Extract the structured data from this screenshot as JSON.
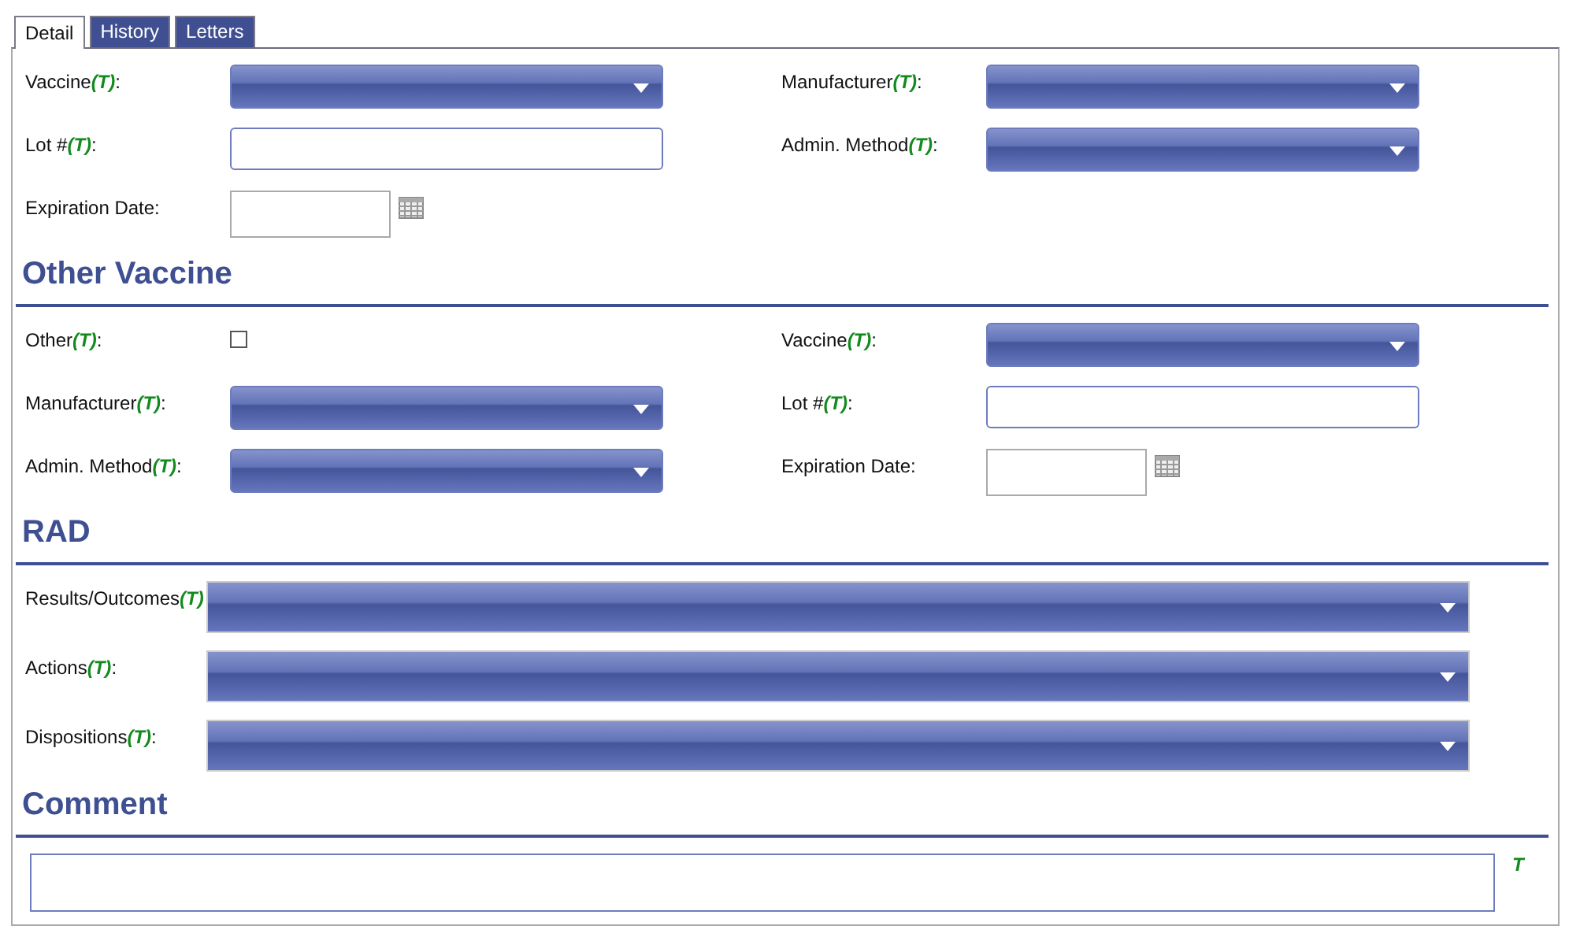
{
  "tabs": [
    {
      "label": "Detail",
      "selected": true
    },
    {
      "label": "History",
      "selected": false
    },
    {
      "label": "Letters",
      "selected": false
    }
  ],
  "sections": [
    {
      "kind": "grid",
      "fields": [
        {
          "label": "Vaccine**(T)**:",
          "kind": "select"
        },
        {
          "label": "Manufacturer**(T)**:",
          "kind": "select"
        },
        {
          "label": "Lot #**(T)**:",
          "kind": "text"
        },
        {
          "label": "Admin. Method**(T)**:",
          "kind": "select"
        },
        {
          "label": "Expiration Date:",
          "kind": "date"
        }
      ]
    },
    {
      "title": "Other Vaccine",
      "kind": "grid",
      "fields": [
        {
          "label": "Other**(T)**:",
          "kind": "checkbox",
          "checked": false
        },
        {
          "label": "Vaccine**(T)**:",
          "kind": "select"
        },
        {
          "label": "Manufacturer**(T)**:",
          "kind": "select"
        },
        {
          "label": "Lot #**(T)**:",
          "kind": "text"
        },
        {
          "label": "Admin. Method**(T)**:",
          "kind": "select"
        },
        {
          "label": "Expiration Date:",
          "kind": "date"
        }
      ]
    },
    {
      "title": "RAD",
      "kind": "wide",
      "fields": [
        {
          "label": "Results/Outcomes**(T)**",
          "kind": "select"
        },
        {
          "label": "Actions**(T)**:",
          "kind": "select"
        },
        {
          "label": "Dispositions**(T)**:",
          "kind": "select"
        }
      ]
    },
    {
      "title": "Comment",
      "kind": "comment",
      "fields": [
        {
          "label": "T",
          "kind": "textarea"
        }
      ]
    }
  ]
}
